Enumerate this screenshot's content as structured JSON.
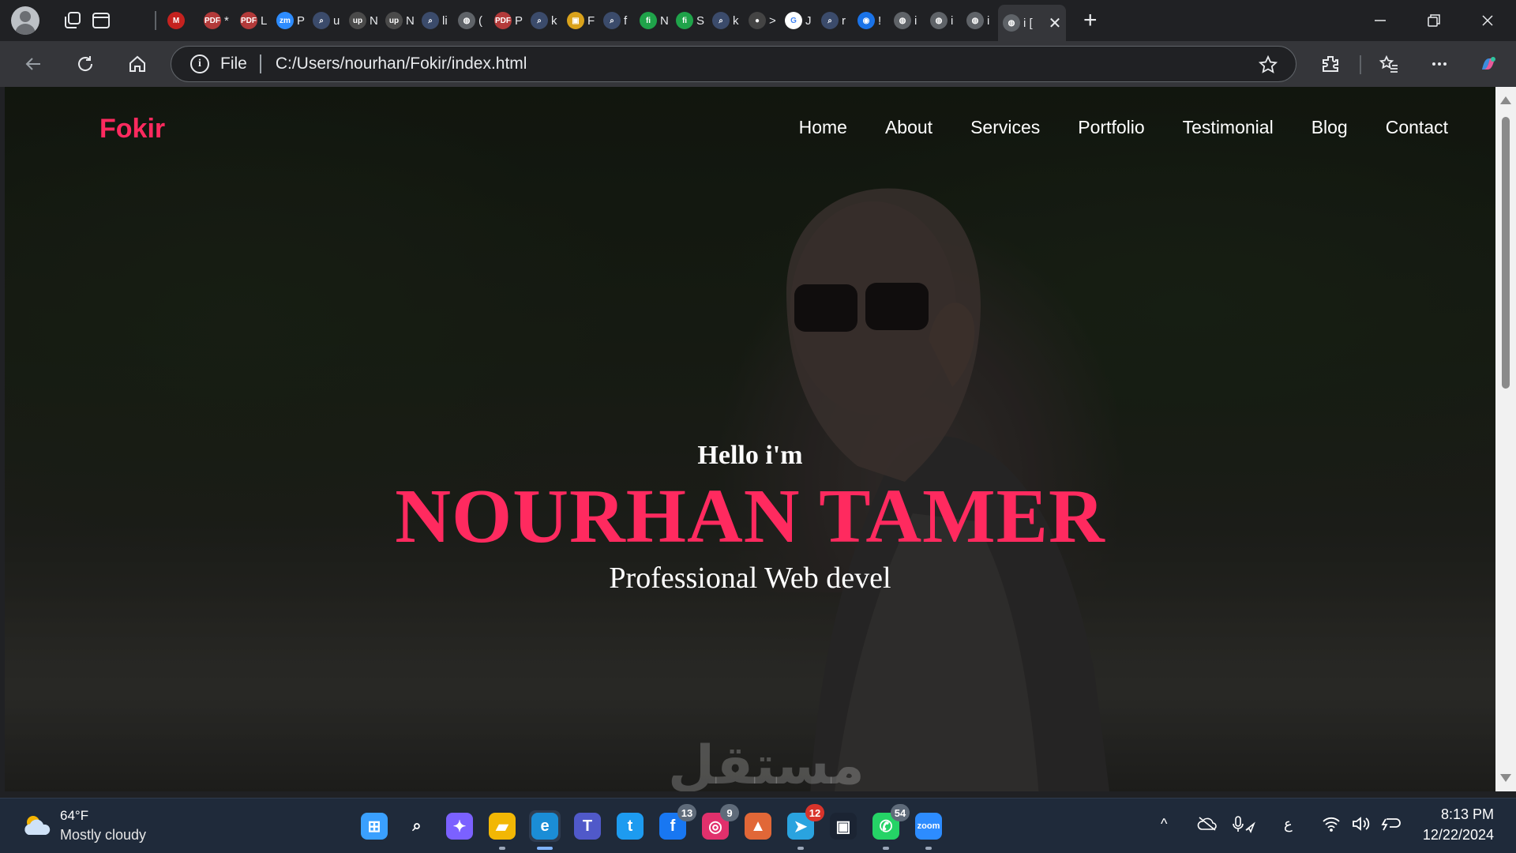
{
  "browser": {
    "tabs": [
      {
        "icon": "gmail-icon",
        "label": "",
        "color": "#c5221f",
        "glyph": "M"
      },
      {
        "icon": "pdf-icon",
        "label": "*",
        "color": "#b33a3a",
        "glyph": "PDF"
      },
      {
        "icon": "pdf-icon",
        "label": "L",
        "color": "#b33a3a",
        "glyph": "PDF"
      },
      {
        "icon": "zoom-icon",
        "label": "P",
        "color": "#2d8cff",
        "glyph": "zm"
      },
      {
        "icon": "search-icon",
        "label": "u",
        "color": "#3b4b6b",
        "glyph": "⌕"
      },
      {
        "icon": "upwork-icon",
        "label": "N",
        "color": "#4a4a4a",
        "glyph": "up"
      },
      {
        "icon": "upwork-icon",
        "label": "N",
        "color": "#4a4a4a",
        "glyph": "up"
      },
      {
        "icon": "search-icon",
        "label": "li",
        "color": "#3b4b6b",
        "glyph": "⌕"
      },
      {
        "icon": "globe-icon",
        "label": "(",
        "color": "#5f6368",
        "glyph": "◍"
      },
      {
        "icon": "pdf-icon",
        "label": "P",
        "color": "#b33a3a",
        "glyph": "PDF"
      },
      {
        "icon": "search-icon",
        "label": "k",
        "color": "#3b4b6b",
        "glyph": "⌕"
      },
      {
        "icon": "box-icon",
        "label": "F",
        "color": "#d9a21b",
        "glyph": "▣"
      },
      {
        "icon": "search-icon",
        "label": "f",
        "color": "#3b4b6b",
        "glyph": "⌕"
      },
      {
        "icon": "freelance-icon",
        "label": "N",
        "color": "#1fa34a",
        "glyph": "fi"
      },
      {
        "icon": "freelance-icon",
        "label": "S",
        "color": "#1fa34a",
        "glyph": "fi"
      },
      {
        "icon": "search-icon",
        "label": "k",
        "color": "#3b4b6b",
        "glyph": "⌕"
      },
      {
        "icon": "avatar-icon",
        "label": ">",
        "color": "#444",
        "glyph": "●"
      },
      {
        "icon": "google-icon",
        "label": "J",
        "color": "#ffffff",
        "glyph": "G"
      },
      {
        "icon": "search-icon",
        "label": "r",
        "color": "#3b4b6b",
        "glyph": "⌕"
      },
      {
        "icon": "circle-icon",
        "label": "!",
        "color": "#1a73e8",
        "glyph": "◉"
      },
      {
        "icon": "globe-icon",
        "label": "i",
        "color": "#5f6368",
        "glyph": "◍"
      },
      {
        "icon": "globe-icon",
        "label": "i",
        "color": "#5f6368",
        "glyph": "◍"
      },
      {
        "icon": "globe-icon",
        "label": "i",
        "color": "#5f6368",
        "glyph": "◍"
      }
    ],
    "active_tab": {
      "label": "i [",
      "close": "✕"
    },
    "new_tab": "+",
    "address": {
      "scheme_label": "File",
      "url": "C:/Users/nourhan/Fokir/index.html"
    }
  },
  "site": {
    "logo": "Fokir",
    "menu": [
      "Home",
      "About",
      "Services",
      "Portfolio",
      "Testimonial",
      "Blog",
      "Contact"
    ],
    "hero": {
      "greeting": "Hello i'm",
      "name": "NOURHAN TAMER",
      "role": "Professional Web devel"
    },
    "watermark": "مستقل",
    "colors": {
      "accent": "#ff2a5f"
    }
  },
  "taskbar": {
    "weather": {
      "temp": "64°F",
      "desc": "Mostly cloudy"
    },
    "apps": [
      {
        "name": "start-icon",
        "glyph": "⊞",
        "color": "#3aa0ff"
      },
      {
        "name": "search-icon",
        "glyph": "⌕",
        "color": "transparent"
      },
      {
        "name": "copilot-icon",
        "glyph": "✦",
        "color": "#7b61ff"
      },
      {
        "name": "file-explorer-icon",
        "glyph": "▰",
        "color": "#f2b705"
      },
      {
        "name": "edge-icon",
        "glyph": "e",
        "color": "#1b8dd6"
      },
      {
        "name": "teams-icon",
        "glyph": "T",
        "color": "#5059c9"
      },
      {
        "name": "twitter-icon",
        "glyph": "t",
        "color": "#1d9bf0"
      },
      {
        "name": "facebook-icon",
        "glyph": "f",
        "color": "#1877f2",
        "badge": "13"
      },
      {
        "name": "instagram-icon",
        "glyph": "◎",
        "color": "#e1306c",
        "badge": "9"
      },
      {
        "name": "matlab-icon",
        "glyph": "▲",
        "color": "#e16737"
      },
      {
        "name": "telegram-icon",
        "glyph": "➤",
        "color": "#2aa3df",
        "badge": "12"
      },
      {
        "name": "recorder-icon",
        "glyph": "▣",
        "color": "#1b2433"
      },
      {
        "name": "whatsapp-icon",
        "glyph": "✆",
        "color": "#25d366",
        "badge": "54"
      },
      {
        "name": "zoom-icon",
        "glyph": "zoom",
        "color": "#2d8cff"
      }
    ],
    "tray": {
      "chevron": "^",
      "lang": "ع"
    },
    "clock": {
      "time": "8:13 PM",
      "date": "12/22/2024"
    }
  }
}
